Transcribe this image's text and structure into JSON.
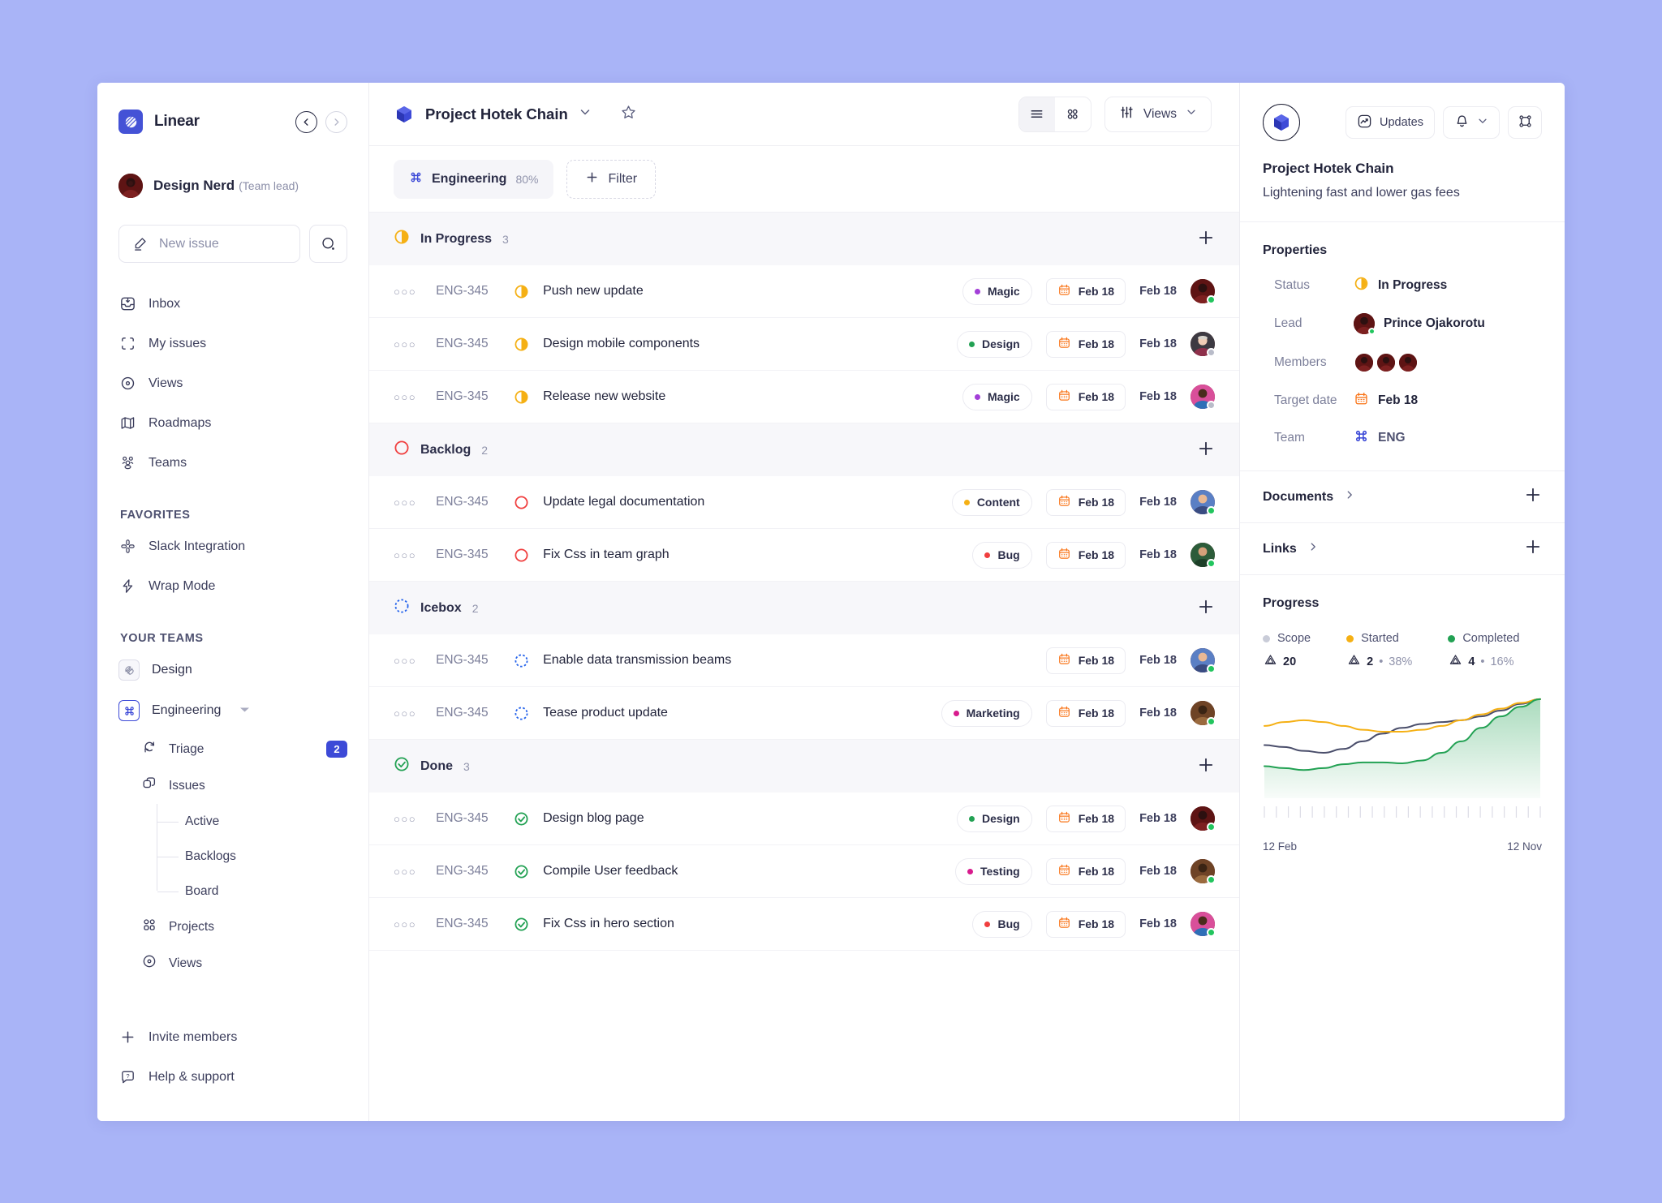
{
  "sidebar": {
    "brand": "Linear",
    "nav_back_icon": "chevron-left-icon",
    "nav_fwd_icon": "chevron-right-icon",
    "user": {
      "name": "Design Nerd",
      "role": "(Team lead)"
    },
    "new_issue_label": "New issue",
    "search_icon": "search-icon",
    "main_items": [
      {
        "label": "Inbox",
        "icon": "inbox-icon"
      },
      {
        "label": "My issues",
        "icon": "my-issues-icon"
      },
      {
        "label": "Views",
        "icon": "views-icon"
      },
      {
        "label": "Roadmaps",
        "icon": "roadmaps-icon"
      },
      {
        "label": "Teams",
        "icon": "teams-icon"
      }
    ],
    "favorites_title": "FAVORITES",
    "favorites": [
      {
        "label": "Slack Integration",
        "icon": "slack-icon"
      },
      {
        "label": "Wrap Mode",
        "icon": "bolt-icon"
      }
    ],
    "teams_title": "YOUR TEAMS",
    "teams": [
      {
        "label": "Design",
        "icon": "design-team-icon",
        "active": false
      },
      {
        "label": "Engineering",
        "icon": "command-icon",
        "active": true
      }
    ],
    "team_children": [
      {
        "label": "Triage",
        "icon": "triage-icon",
        "badge": "2"
      },
      {
        "label": "Issues",
        "icon": "issues-icon",
        "badge": ""
      }
    ],
    "issue_leaves": [
      "Active",
      "Backlogs",
      "Board"
    ],
    "team_children2": [
      {
        "label": "Projects",
        "icon": "projects-icon"
      },
      {
        "label": "Views",
        "icon": "views-icon"
      }
    ],
    "bottom": [
      {
        "label": "Invite members",
        "icon": "plus-icon"
      },
      {
        "label": "Help & support",
        "icon": "help-icon"
      }
    ]
  },
  "center": {
    "project_name": "Project Hotek Chain",
    "project_icon": "cube-icon",
    "dropdown_icon": "chevron-down-icon",
    "favorite_icon": "star-icon",
    "view_list_icon": "list-view-icon",
    "view_grid_icon": "grid-view-icon",
    "views_label": "Views",
    "views_icon": "sliders-icon",
    "team_chip": {
      "label": "Engineering",
      "percent": "80%",
      "icon": "command-icon"
    },
    "filter_label": "Filter",
    "filter_icon": "plus-icon",
    "add_icon": "plus-icon",
    "groups": [
      {
        "name": "In Progress",
        "count": "3",
        "status": "in-progress",
        "color": "#f5b014",
        "rows": [
          {
            "id": "ENG-345",
            "title": "Push new update",
            "tag": "Magic",
            "tag_color": "#a33fd8",
            "date_chip": "Feb 18",
            "date": "Feb 18",
            "avatar": "red",
            "presence": "#22c55e"
          },
          {
            "id": "ENG-345",
            "title": "Design  mobile components",
            "tag": "Design",
            "tag_color": "#22a153",
            "date_chip": "Feb 18",
            "date": "Feb 18",
            "avatar": "pale",
            "presence": "#b9bcc9"
          },
          {
            "id": "ENG-345",
            "title": "Release new website",
            "tag": "Magic",
            "tag_color": "#a33fd8",
            "date_chip": "Feb 18",
            "date": "Feb 18",
            "avatar": "teal",
            "presence": "#b9bcc9"
          }
        ]
      },
      {
        "name": "Backlog",
        "count": "2",
        "status": "backlog",
        "color": "#f03e3e",
        "rows": [
          {
            "id": "ENG-345",
            "title": "Update legal documentation",
            "tag": "Content",
            "tag_color": "#f5b014",
            "date_chip": "Feb 18",
            "date": "Feb 18",
            "avatar": "blue",
            "presence": "#22c55e"
          },
          {
            "id": "ENG-345",
            "title": "Fix Css in team graph",
            "tag": "Bug",
            "tag_color": "#f03e3e",
            "date_chip": "Feb 18",
            "date": "Feb 18",
            "avatar": "green",
            "presence": "#22c55e"
          }
        ]
      },
      {
        "name": "Icebox",
        "count": "2",
        "status": "icebox",
        "color": "#2563eb",
        "rows": [
          {
            "id": "ENG-345",
            "title": "Enable  data transmission beams",
            "tag": "",
            "tag_color": "",
            "date_chip": "Feb 18",
            "date": "Feb 18",
            "avatar": "blue",
            "presence": "#22c55e"
          },
          {
            "id": "ENG-345",
            "title": "Tease product update",
            "tag": "Marketing",
            "tag_color": "#d81b8d",
            "date_chip": "Feb 18",
            "date": "Feb 18",
            "avatar": "brown",
            "presence": "#22c55e"
          }
        ]
      },
      {
        "name": "Done",
        "count": "3",
        "status": "done",
        "color": "#22a153",
        "rows": [
          {
            "id": "ENG-345",
            "title": "Design blog page",
            "tag": "Design",
            "tag_color": "#22a153",
            "date_chip": "Feb 18",
            "date": "Feb 18",
            "avatar": "red",
            "presence": "#22c55e"
          },
          {
            "id": "ENG-345",
            "title": "Compile User feedback",
            "tag": "Testing",
            "tag_color": "#d81b8d",
            "date_chip": "Feb 18",
            "date": "Feb 18",
            "avatar": "brown",
            "presence": "#22c55e"
          },
          {
            "id": "ENG-345",
            "title": "Fix Css in hero section",
            "tag": "Bug",
            "tag_color": "#f03e3e",
            "date_chip": "Feb 18",
            "date": "Feb 18",
            "avatar": "teal",
            "presence": "#22c55e"
          }
        ]
      }
    ]
  },
  "right": {
    "logo_icon": "cube-icon",
    "updates_label": "Updates",
    "updates_icon": "activity-icon",
    "bell_icon": "bell-icon",
    "bell_caret_icon": "chevron-down-icon",
    "frame_icon": "frame-icon",
    "title": "Project Hotek Chain",
    "subtitle": "Lightening fast and lower gas fees",
    "properties_title": "Properties",
    "properties": [
      {
        "key": "Status",
        "value": "In Progress",
        "icon": "in-progress-icon"
      },
      {
        "key": "Lead",
        "value": "Prince Ojakorotu",
        "icon": "avatar-icon"
      },
      {
        "key": "Members",
        "value": "",
        "icon": "avatar-stack-icon"
      },
      {
        "key": "Target date",
        "value": "Feb 18",
        "icon": "calendar-icon"
      },
      {
        "key": "Team",
        "value": "ENG",
        "icon": "command-icon"
      }
    ],
    "documents_label": "Documents",
    "links_label": "Links",
    "expand_icon": "chevron-right-icon",
    "add_icon": "plus-icon",
    "progress_title": "Progress"
  },
  "chart_data": {
    "type": "area",
    "title": "Progress",
    "xlabel": "",
    "ylabel": "",
    "x_ticks": [
      "12 Feb",
      "12 Nov"
    ],
    "grid": false,
    "legend_position": "top",
    "legend": [
      {
        "name": "Scope",
        "color": "#c9ccd8",
        "count": "20",
        "percent": ""
      },
      {
        "name": "Started",
        "color": "#f5b014",
        "count": "2",
        "percent": "38%"
      },
      {
        "name": "Completed",
        "color": "#22a153",
        "count": "4",
        "percent": "16%"
      }
    ],
    "series": [
      {
        "name": "Scope",
        "color": "#4a4e6b",
        "values": [
          52,
          50,
          46,
          44,
          48,
          56,
          64,
          70,
          74,
          76,
          78,
          82,
          88,
          95,
          100
        ]
      },
      {
        "name": "Started",
        "color": "#f5b014",
        "values": [
          72,
          76,
          78,
          76,
          72,
          68,
          66,
          66,
          68,
          72,
          78,
          84,
          90,
          96,
          100
        ]
      },
      {
        "name": "Completed",
        "color": "#22a153",
        "values": [
          30,
          28,
          26,
          28,
          32,
          34,
          34,
          33,
          36,
          44,
          56,
          70,
          82,
          92,
          100
        ]
      }
    ],
    "ylim": [
      0,
      110
    ]
  }
}
